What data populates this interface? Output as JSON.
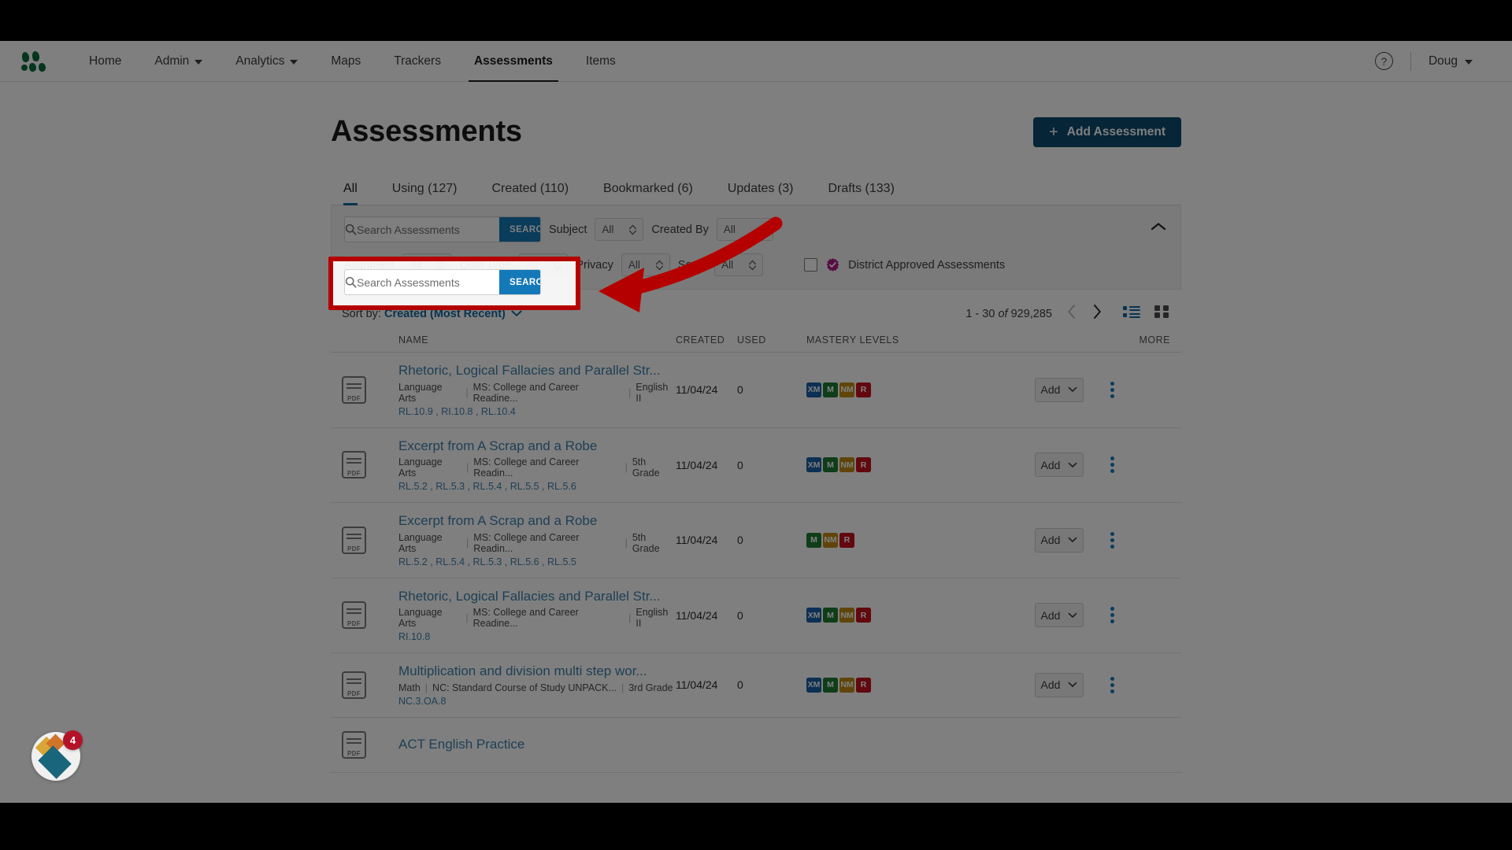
{
  "topnav": {
    "logo_name": "illuminate-logo",
    "items": [
      {
        "label": "Home",
        "has_caret": false,
        "active": false
      },
      {
        "label": "Admin",
        "has_caret": true,
        "active": false
      },
      {
        "label": "Analytics",
        "has_caret": true,
        "active": false
      },
      {
        "label": "Maps",
        "has_caret": false,
        "active": false
      },
      {
        "label": "Trackers",
        "has_caret": false,
        "active": false
      },
      {
        "label": "Assessments",
        "has_caret": false,
        "active": true
      },
      {
        "label": "Items",
        "has_caret": false,
        "active": false
      }
    ],
    "help_icon": "question-circle-icon",
    "user": "Doug"
  },
  "header": {
    "title": "Assessments",
    "add_button": "Add Assessment",
    "add_button_icon": "plus-icon",
    "add_button_color": "#0c4a6e"
  },
  "tabs": [
    {
      "label": "All",
      "active": true
    },
    {
      "label": "Using (127)",
      "active": false
    },
    {
      "label": "Created (110)",
      "active": false
    },
    {
      "label": "Bookmarked (6)",
      "active": false
    },
    {
      "label": "Updates (3)",
      "active": false
    },
    {
      "label": "Drafts (133)",
      "active": false
    }
  ],
  "filters": {
    "search": {
      "placeholder": "Search Assessments",
      "value": "",
      "button_label": "SEARCH",
      "icon": "search-icon",
      "button_color": "#1479b8"
    },
    "row1": [
      {
        "label": "Subject",
        "value": "All"
      },
      {
        "label": "Created By",
        "value": "All"
      }
    ],
    "row2": [
      {
        "label": "Alignment",
        "value": "All"
      },
      {
        "label": "Qstn Type",
        "value": "All"
      },
      {
        "label": "Privacy",
        "value": "All"
      },
      {
        "label": "Scale",
        "value": "All"
      }
    ],
    "district_approved": {
      "label": "District Approved Assessments",
      "checked": false,
      "badge_icon": "verified-badge-icon",
      "badge_color": "#b01a85"
    },
    "collapse_icon": "chevron-up-icon"
  },
  "listbar": {
    "sort_label": "Sort by:",
    "sort_value": "Created (Most Recent)",
    "sort_caret": "chevron-down-icon",
    "range": "1 - 30",
    "of": "of",
    "total": "929,285",
    "prev_icon": "chevron-left-icon",
    "next_icon": "chevron-right-icon",
    "list_view_icon": "list-view-icon",
    "grid_view_icon": "grid-view-icon"
  },
  "table": {
    "columns": [
      "NAME",
      "CREATED",
      "USED",
      "MASTERY LEVELS",
      "MORE"
    ],
    "add_label": "Add",
    "add_caret": "chevron-down-icon",
    "more_icon": "kebab-menu-icon",
    "file_icon": "pdf-file-icon",
    "rows": [
      {
        "name": "Rhetoric, Logical Fallacies and Parallel Str...",
        "subject": "Language Arts",
        "standard_set": "MS: College and Career Readine...",
        "grade": "English II",
        "standards": "RL.10.9 , RI.10.8 , RL.10.4",
        "created": "11/04/24",
        "used": "0",
        "levels": [
          "XM",
          "M",
          "NM",
          "R"
        ]
      },
      {
        "name": "Excerpt from A Scrap and a Robe",
        "subject": "Language Arts",
        "standard_set": "MS: College and Career Readin...",
        "grade": "5th Grade",
        "standards": "RL.5.2 , RL.5.3 , RL.5.4 , RL.5.5 , RL.5.6",
        "created": "11/04/24",
        "used": "0",
        "levels": [
          "XM",
          "M",
          "NM",
          "R"
        ]
      },
      {
        "name": "Excerpt from A Scrap and a Robe",
        "subject": "Language Arts",
        "standard_set": "MS: College and Career Readin...",
        "grade": "5th Grade",
        "standards": "RL.5.2 , RL.5.4 , RL.5.3 , RL.5.6 , RL.5.5",
        "created": "11/04/24",
        "used": "0",
        "levels": [
          "M",
          "NM",
          "R"
        ]
      },
      {
        "name": "Rhetoric, Logical Fallacies and Parallel Str...",
        "subject": "Language Arts",
        "standard_set": "MS: College and Career Readine...",
        "grade": "English II",
        "standards": "RI.10.8",
        "created": "11/04/24",
        "used": "0",
        "levels": [
          "XM",
          "M",
          "NM",
          "R"
        ]
      },
      {
        "name": "Multiplication and division multi step wor...",
        "subject": "Math",
        "standard_set": "NC: Standard Course of Study UNPACK...",
        "grade": "3rd Grade",
        "standards": "NC.3.OA.8",
        "created": "11/04/24",
        "used": "0",
        "levels": [
          "XM",
          "M",
          "NM",
          "R"
        ]
      },
      {
        "name": "ACT English Practice",
        "subject": "",
        "standard_set": "",
        "grade": "",
        "standards": "",
        "created": "",
        "used": "",
        "levels": []
      }
    ]
  },
  "annotation": {
    "highlight_color": "#b50000",
    "arrow_name": "red-annotation-arrow",
    "box_name": "red-highlight-box-search"
  },
  "widget": {
    "name": "notification-widget",
    "count": "4"
  }
}
